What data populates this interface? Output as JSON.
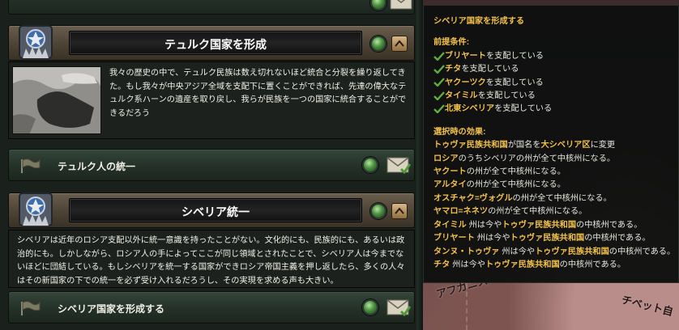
{
  "focus_tree": {
    "turkic": {
      "title": "テュルク国家を形成",
      "description": "我々の歴史の中で、テュルク民族は数え切れないほど統合と分裂を繰り返してきた。もし我々が中央アジア全域を支配下に置くことができれば、先達の偉大なテュルク系ハーンの遺産を取り戻し、我らが民族を一つの国家に統合することができるだろう",
      "decision_label": "テュルク人の統一"
    },
    "siberia": {
      "title": "シベリア統一",
      "description": "シベリアは近年のロシア支配以外に統一意識を持ったことがない。文化的にも、民族的にも、あるいは政治的にも。しかしながら、ロシア人の手によってここが同じ領域とされたことで、シベリア人は今までないほどに団結している。もしシベリアを統一する国家ができロシア帝国主義を押し返したら、多くの人々はその新国家の下での統一を必ず受け入れるだろうし、その実現を求める声も大きい。",
      "decision_label": "シベリア国家を形成する"
    }
  },
  "tooltip": {
    "title": "シベリア国家を形成する",
    "prereq_heading": "前提条件:",
    "prereqs": [
      {
        "name": "ブリヤート",
        "suffix": "を支配している"
      },
      {
        "name": "チタ",
        "suffix": "を支配している"
      },
      {
        "name": "ヤクーツク",
        "suffix": "を支配している"
      },
      {
        "name": "タイミル",
        "suffix": "を支配している"
      },
      {
        "name": "北東シベリア",
        "suffix": "を支配している"
      }
    ],
    "effects_heading": "選択時の効果:",
    "effects": [
      {
        "parts": [
          {
            "t": "トゥヴァ民族共和国",
            "h": true
          },
          {
            "t": "が国名を"
          },
          {
            "t": "大シベリア区",
            "h": true
          },
          {
            "t": "に変更"
          }
        ]
      },
      {
        "parts": [
          {
            "t": "ロシア",
            "h": true
          },
          {
            "t": "のうちシベリアの州が全て中核州になる。"
          }
        ]
      },
      {
        "parts": [
          {
            "t": "ヤクート",
            "h": true
          },
          {
            "t": "の州が全て中核州になる。"
          }
        ]
      },
      {
        "parts": [
          {
            "t": "アルタイ",
            "h": true
          },
          {
            "t": "の州が全て中核州になる。"
          }
        ]
      },
      {
        "parts": [
          {
            "t": "オスチャク=ヴォグル",
            "h": true
          },
          {
            "t": "の州が全て中核州になる。"
          }
        ]
      },
      {
        "parts": [
          {
            "t": "ヤマロ=ネネツ",
            "h": true
          },
          {
            "t": "の州が全て中核州になる。"
          }
        ]
      },
      {
        "parts": [
          {
            "t": "タイミル",
            "h": true
          },
          {
            "t": " 州は今や"
          },
          {
            "t": "トゥヴァ民族共和国",
            "h": true
          },
          {
            "t": "の中核州である。"
          }
        ]
      },
      {
        "parts": [
          {
            "t": "ブリヤート",
            "h": true
          },
          {
            "t": " 州は今や"
          },
          {
            "t": "トゥヴァ民族共和国",
            "h": true
          },
          {
            "t": "の中核州である。"
          }
        ]
      },
      {
        "parts": [
          {
            "t": "タンヌ・トゥヴァ",
            "h": true
          },
          {
            "t": " 州は今や"
          },
          {
            "t": "トゥヴァ民族共和国",
            "h": true
          },
          {
            "t": "の中核州である。"
          }
        ]
      },
      {
        "parts": [
          {
            "t": "チタ",
            "h": true
          },
          {
            "t": " 州は今や"
          },
          {
            "t": "トゥヴァ民族共和国",
            "h": true
          },
          {
            "t": "の中核州である。"
          }
        ]
      }
    ]
  },
  "map": {
    "labels": [
      "アフガニス",
      "チベット自"
    ]
  },
  "colors": {
    "highlight": "#f2c14a",
    "check": "#5fae3e",
    "panel": "#1a201c"
  },
  "icons": [
    "flag-icon",
    "green-orb-icon",
    "envelope-check-icon",
    "collapse-arrow-icon",
    "emblem-icon",
    "checkmark-icon"
  ]
}
